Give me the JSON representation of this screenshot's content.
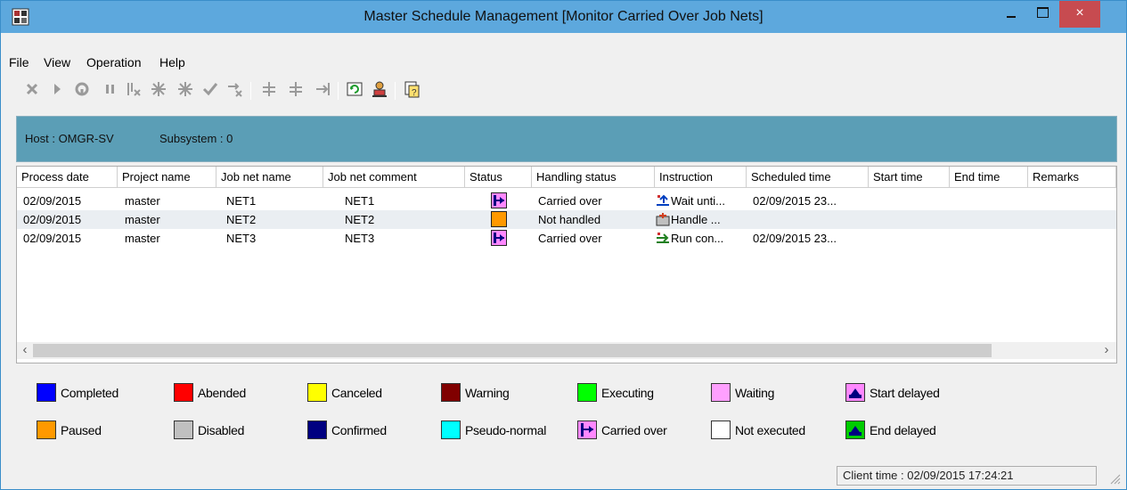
{
  "window": {
    "title": "Master Schedule Management [Monitor Carried Over Job Nets]",
    "close_glyph": "×",
    "accent": "#5da8dd"
  },
  "menu": {
    "items": [
      "File",
      "View",
      "Operation",
      "Help"
    ]
  },
  "toolbar": {
    "icons": [
      "cancel-icon",
      "start-icon",
      "rerun-icon",
      "pause-icon",
      "disable-icon",
      "force-stop-icon",
      "release-icon",
      "confirm-icon",
      "skip-icon",
      "handle-icon",
      "handle-alt-icon",
      "handle-next-icon",
      "refresh-icon",
      "person-icon",
      "help-icon"
    ]
  },
  "infobar": {
    "host": "Host : OMGR-SV",
    "subsystem": "Subsystem : 0",
    "color": "#5b9eb6"
  },
  "grid": {
    "columns": [
      "Process date",
      "Project name",
      "Job net name",
      "Job net comment",
      "Status",
      "Handling status",
      "Instruction",
      "Scheduled time",
      "Start time",
      "End time",
      "Remarks"
    ],
    "rows": [
      {
        "process_date": "02/09/2015",
        "project": "master",
        "jobnet": "NET1",
        "comment": "NET1",
        "status": "carried-over",
        "handling": "Carried over",
        "instruction": "Wait unti...",
        "scheduled": "02/09/2015 23..."
      },
      {
        "process_date": "02/09/2015",
        "project": "master",
        "jobnet": "NET2",
        "comment": "NET2",
        "status": "paused",
        "handling": "Not handled",
        "instruction": "Handle ...",
        "scheduled": ""
      },
      {
        "process_date": "02/09/2015",
        "project": "master",
        "jobnet": "NET3",
        "comment": "NET3",
        "status": "carried-over",
        "handling": "Carried over",
        "instruction": "Run con...",
        "scheduled": "02/09/2015 23..."
      }
    ],
    "scroll_left": "‹",
    "scroll_right": "›"
  },
  "legend": {
    "row1": [
      {
        "label": "Completed",
        "color": "#0000ff"
      },
      {
        "label": "Abended",
        "color": "#ff0000"
      },
      {
        "label": "Canceled",
        "color": "#ffff00"
      },
      {
        "label": "Warning",
        "color": "#800000"
      },
      {
        "label": "Executing",
        "color": "#00ff00"
      },
      {
        "label": "Waiting",
        "color": "#ffa0ff"
      },
      {
        "label": "Start delayed",
        "color": "#ff88ff"
      }
    ],
    "row2": [
      {
        "label": "Paused",
        "color": "#ff9900"
      },
      {
        "label": "Disabled",
        "color": "#c0c0c0"
      },
      {
        "label": "Confirmed",
        "color": "#000080"
      },
      {
        "label": "Pseudo-normal",
        "color": "#00ffff"
      },
      {
        "label": "Carried over",
        "color": "#ff88ff"
      },
      {
        "label": "Not executed",
        "color": "#ffffff"
      },
      {
        "label": "End delayed",
        "color": "#00cc00"
      }
    ]
  },
  "status_bar": {
    "client_time": "Client time : 02/09/2015 17:24:21"
  }
}
